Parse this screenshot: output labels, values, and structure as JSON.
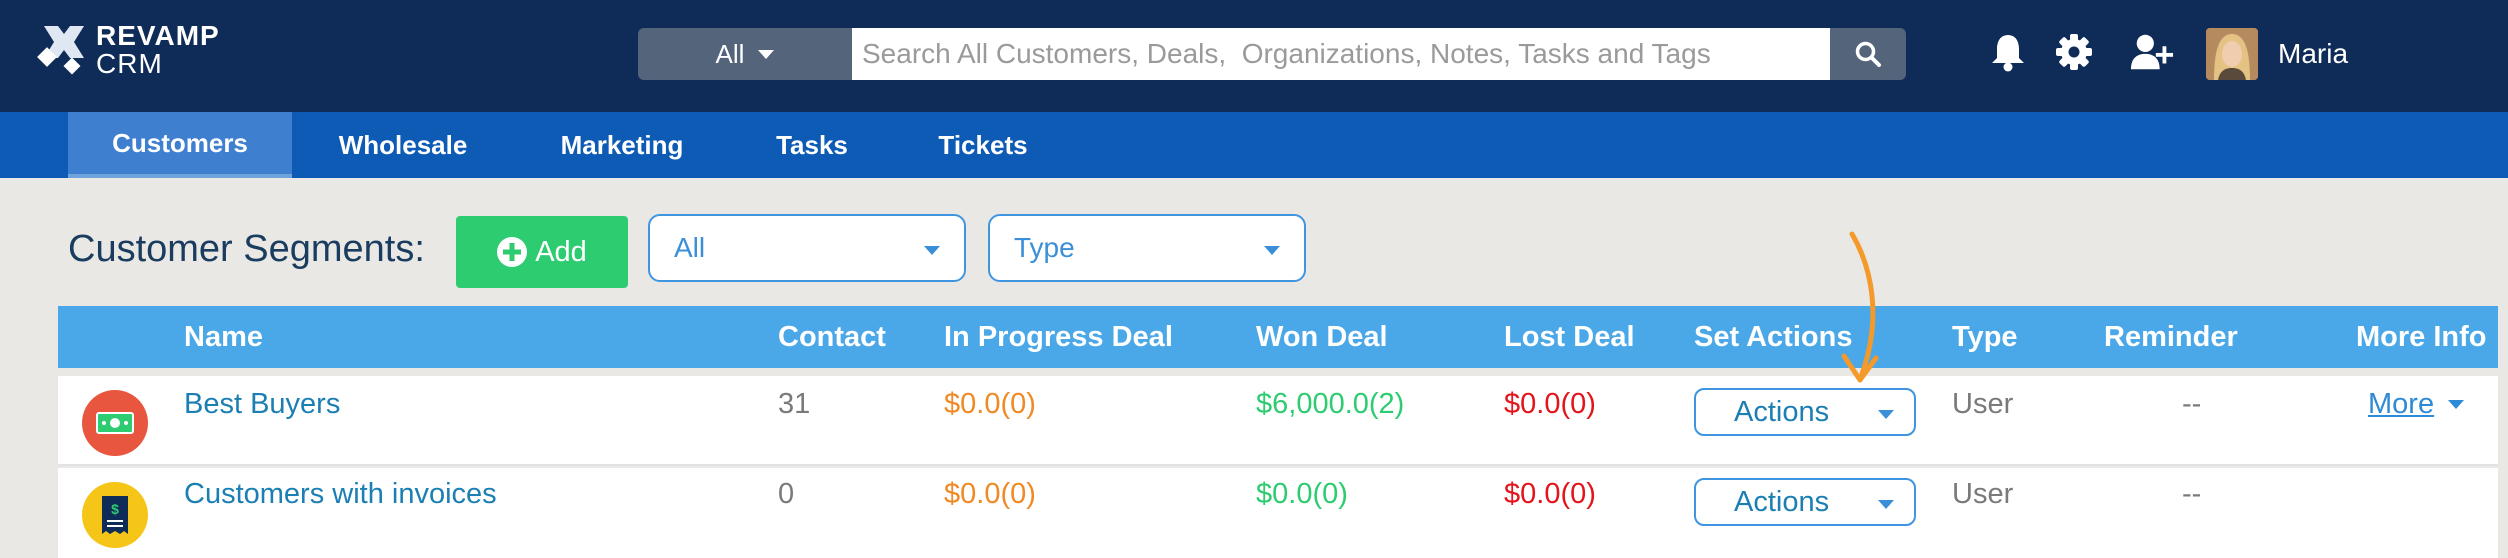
{
  "header": {
    "logo_line1": "REVAMP",
    "logo_line2": "CRM",
    "search_scope": "All",
    "search_placeholder": "Search All Customers, Deals,  Organizations, Notes, Tasks and Tags",
    "username": "Maria",
    "icons": [
      "bell-icon",
      "gear-icon",
      "add-user-icon",
      "search-icon"
    ]
  },
  "tabs": [
    "Customers",
    "Wholesale",
    "Marketing",
    "Tasks",
    "Tickets"
  ],
  "active_tab": "Customers",
  "segments": {
    "title": "Customer Segments:",
    "add_label": "Add",
    "filter_value": "All",
    "type_value": "Type"
  },
  "table": {
    "headers": [
      "Name",
      "Contact",
      "In Progress Deal",
      "Won Deal",
      "Lost Deal",
      "Set Actions",
      "Type",
      "Reminder",
      "More Info"
    ],
    "rows": [
      {
        "icon": "money-icon",
        "name": "Best Buyers",
        "contact": "31",
        "in_progress": "$0.0(0)",
        "won": "$6,000.0(2)",
        "lost": "$0.0(0)",
        "actions": "Actions",
        "type": "User",
        "reminder": "--",
        "more": "More"
      },
      {
        "icon": "invoice-icon",
        "name": "Customers with invoices",
        "contact": "0",
        "in_progress": "$0.0(0)",
        "won": "$0.0(0)",
        "lost": "$0.0(0)",
        "actions": "Actions",
        "type": "User",
        "reminder": "--"
      }
    ]
  },
  "colors": {
    "header_bg": "#0e2c57",
    "tab_bg": "#0e5bb5",
    "table_header_bg": "#4aa8e8",
    "add_green": "#2ecc71",
    "annotation_orange": "#f39a2b"
  }
}
